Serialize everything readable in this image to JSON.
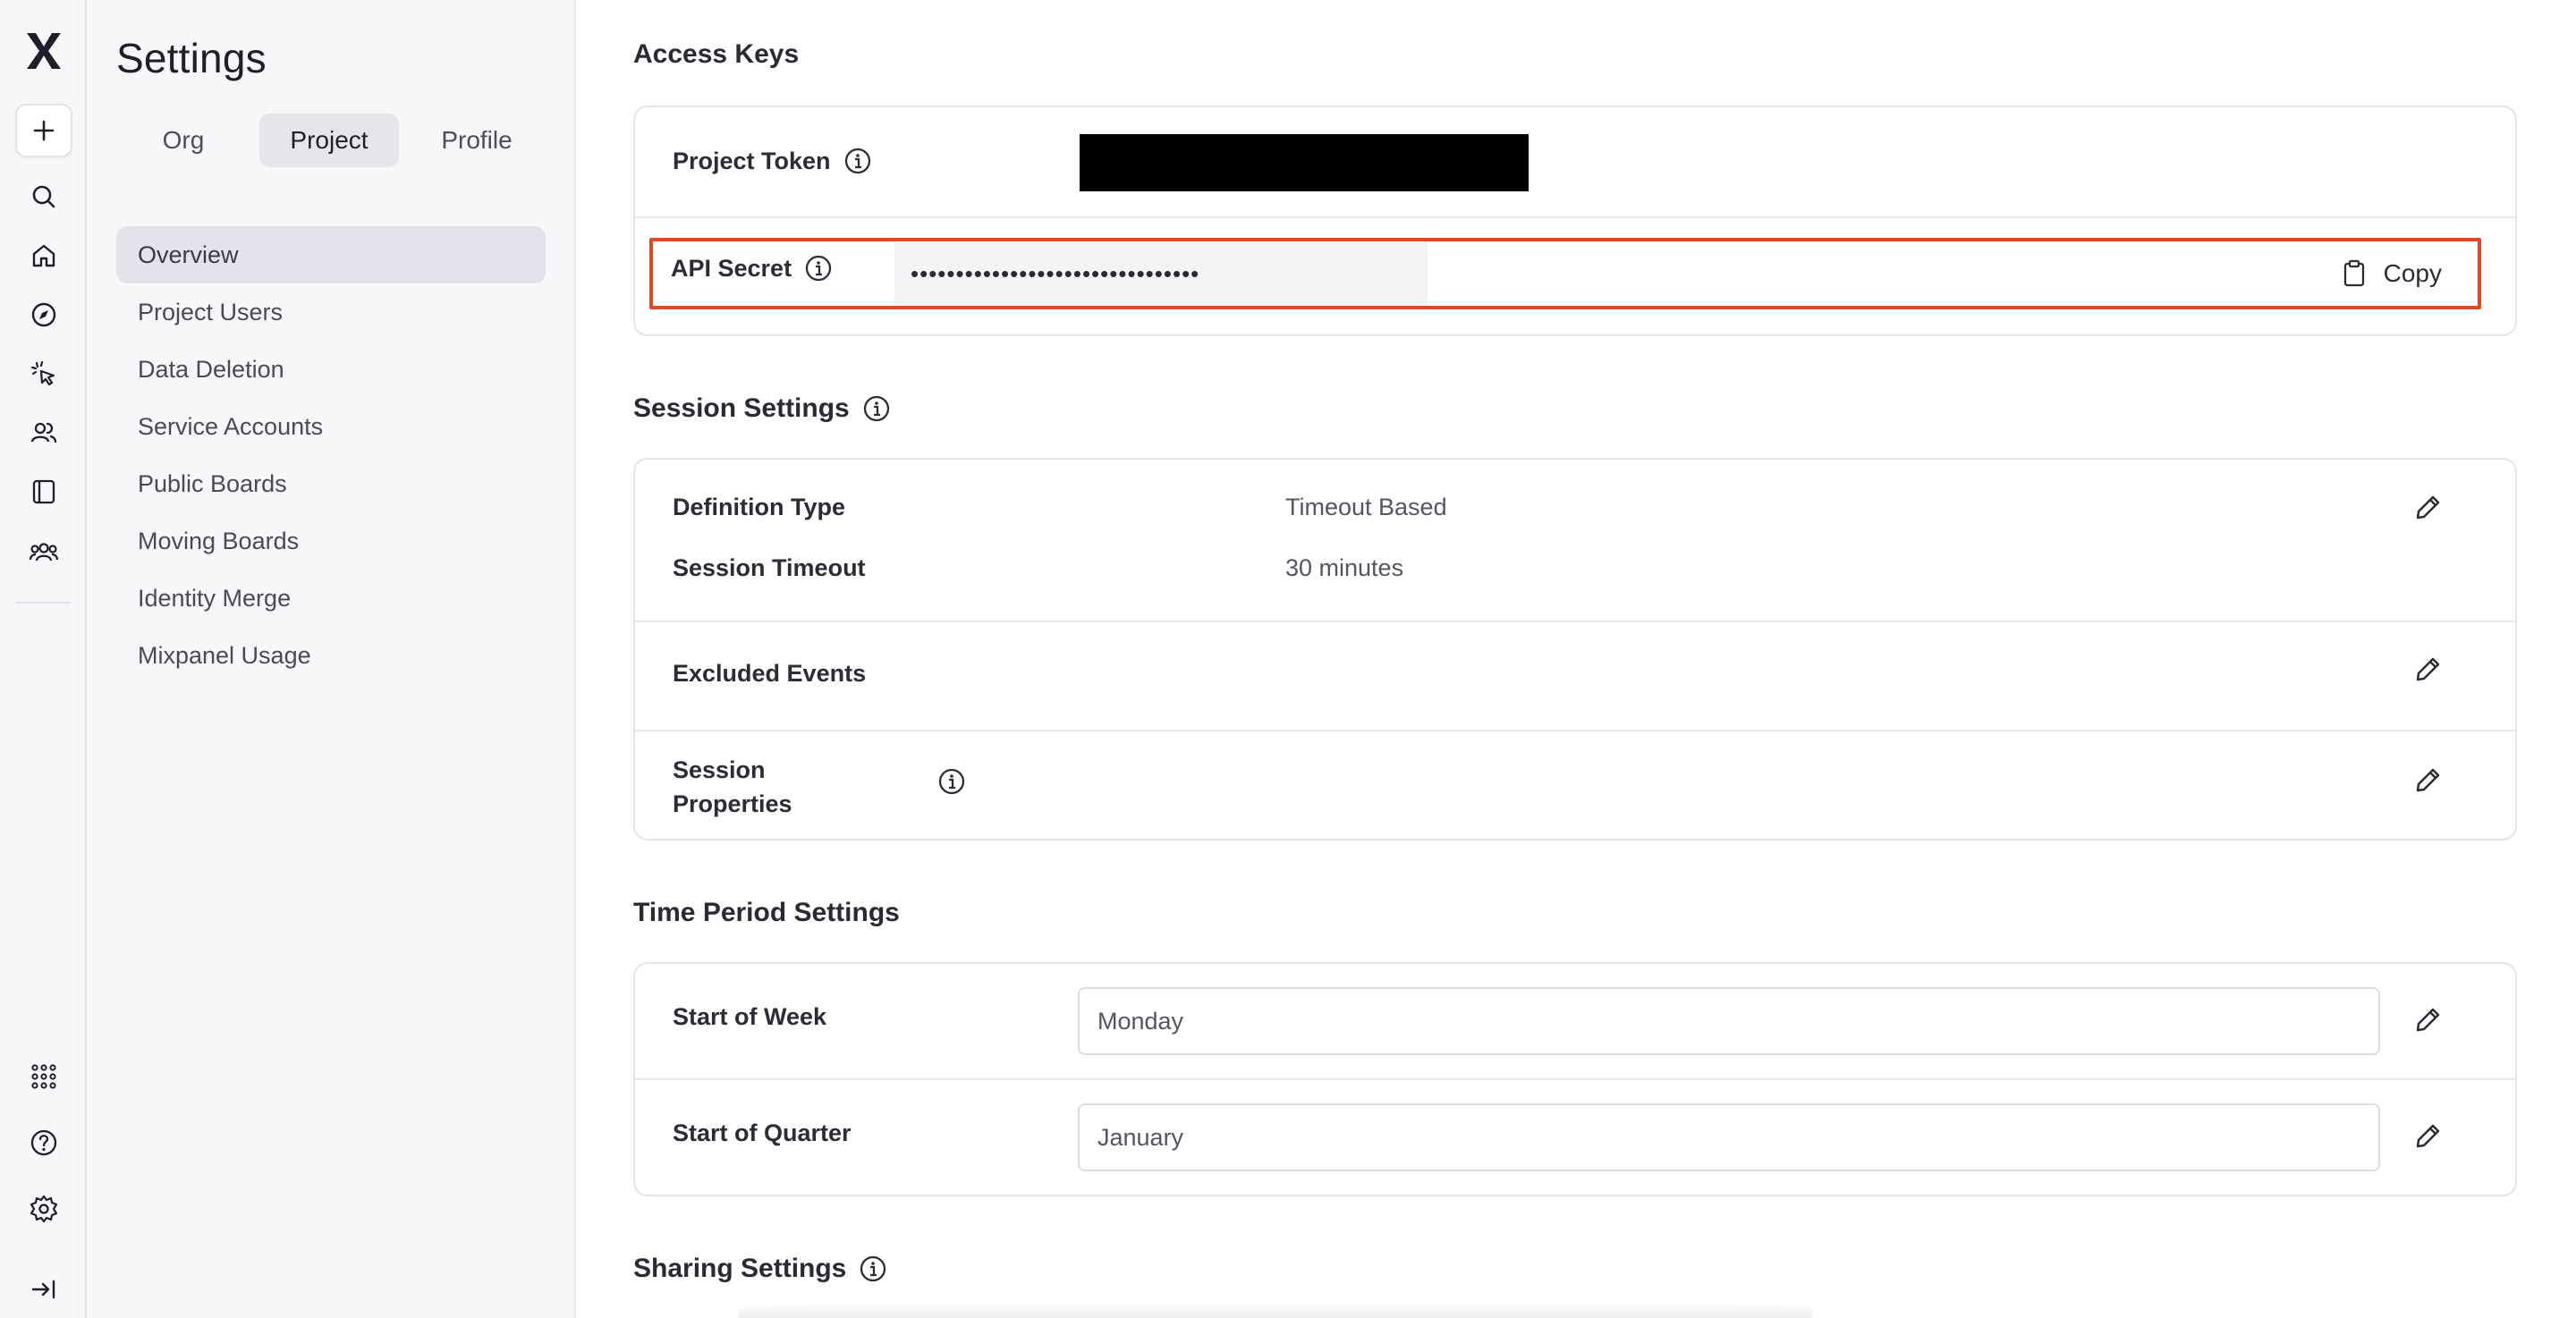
{
  "sidebar": {
    "title": "Settings",
    "segments": [
      {
        "label": "Org",
        "active": false
      },
      {
        "label": "Project",
        "active": true
      },
      {
        "label": "Profile",
        "active": false
      }
    ],
    "nav_items": [
      {
        "label": "Overview",
        "active": true
      },
      {
        "label": "Project Users",
        "active": false
      },
      {
        "label": "Data Deletion",
        "active": false
      },
      {
        "label": "Service Accounts",
        "active": false
      },
      {
        "label": "Public Boards",
        "active": false
      },
      {
        "label": "Moving Boards",
        "active": false
      },
      {
        "label": "Identity Merge",
        "active": false
      },
      {
        "label": "Mixpanel Usage",
        "active": false
      }
    ]
  },
  "rail": {
    "icons": [
      "mixpanel-logo-icon",
      "plus-icon",
      "search-icon",
      "home-icon",
      "compass-icon",
      "cursor-click-icon",
      "users-icon",
      "book-icon",
      "team-icon",
      "apps-grid-icon",
      "help-icon",
      "gear-icon",
      "expand-sidebar-icon"
    ]
  },
  "access_keys": {
    "title": "Access Keys",
    "project_token_label": "Project Token",
    "api_secret_label": "API Secret",
    "api_secret_value": "••••••••••••••••••••••••••••••••",
    "copy_label": "Copy"
  },
  "session_settings": {
    "title": "Session Settings",
    "definition_type_label": "Definition Type",
    "definition_type_value": "Timeout Based",
    "session_timeout_label": "Session Timeout",
    "session_timeout_value": "30 minutes",
    "excluded_events_label": "Excluded Events",
    "session_properties_label_line1": "Session",
    "session_properties_label_line2": "Properties"
  },
  "time_period_settings": {
    "title": "Time Period Settings",
    "start_of_week_label": "Start of Week",
    "start_of_week_value": "Monday",
    "start_of_quarter_label": "Start of Quarter",
    "start_of_quarter_value": "January"
  },
  "sharing_settings": {
    "title": "Sharing Settings"
  },
  "colors": {
    "highlight": "#dd4a2a",
    "active_nav": "#e4e3ec",
    "sidebar_bg": "#f7f7f9"
  }
}
